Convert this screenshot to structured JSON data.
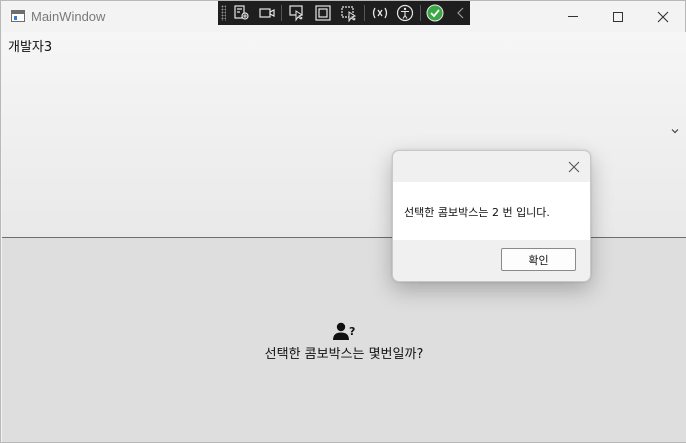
{
  "window": {
    "title": "MainWindow"
  },
  "main": {
    "combo_selected": "개발자3",
    "question": "선택한 콤보박스는 몇번일까?"
  },
  "dialog": {
    "message": "선택한 콤보박스는 2 번 입니다.",
    "ok_label": "확인"
  },
  "icons": {
    "app": "app-window-icon",
    "devtools": [
      "select-element-icon",
      "video-record-icon",
      "pointer-icon",
      "layout-adorner-icon",
      "preview-selection-icon",
      "hot-reload-icon",
      "accessibility-icon",
      "check-circle-icon",
      "collapse-chevron-icon"
    ],
    "user": "user-question-icon"
  },
  "colors": {
    "devbar_bg": "#1e1e1e",
    "check_green": "#3aa845",
    "bottom_panel": "#dedede"
  }
}
